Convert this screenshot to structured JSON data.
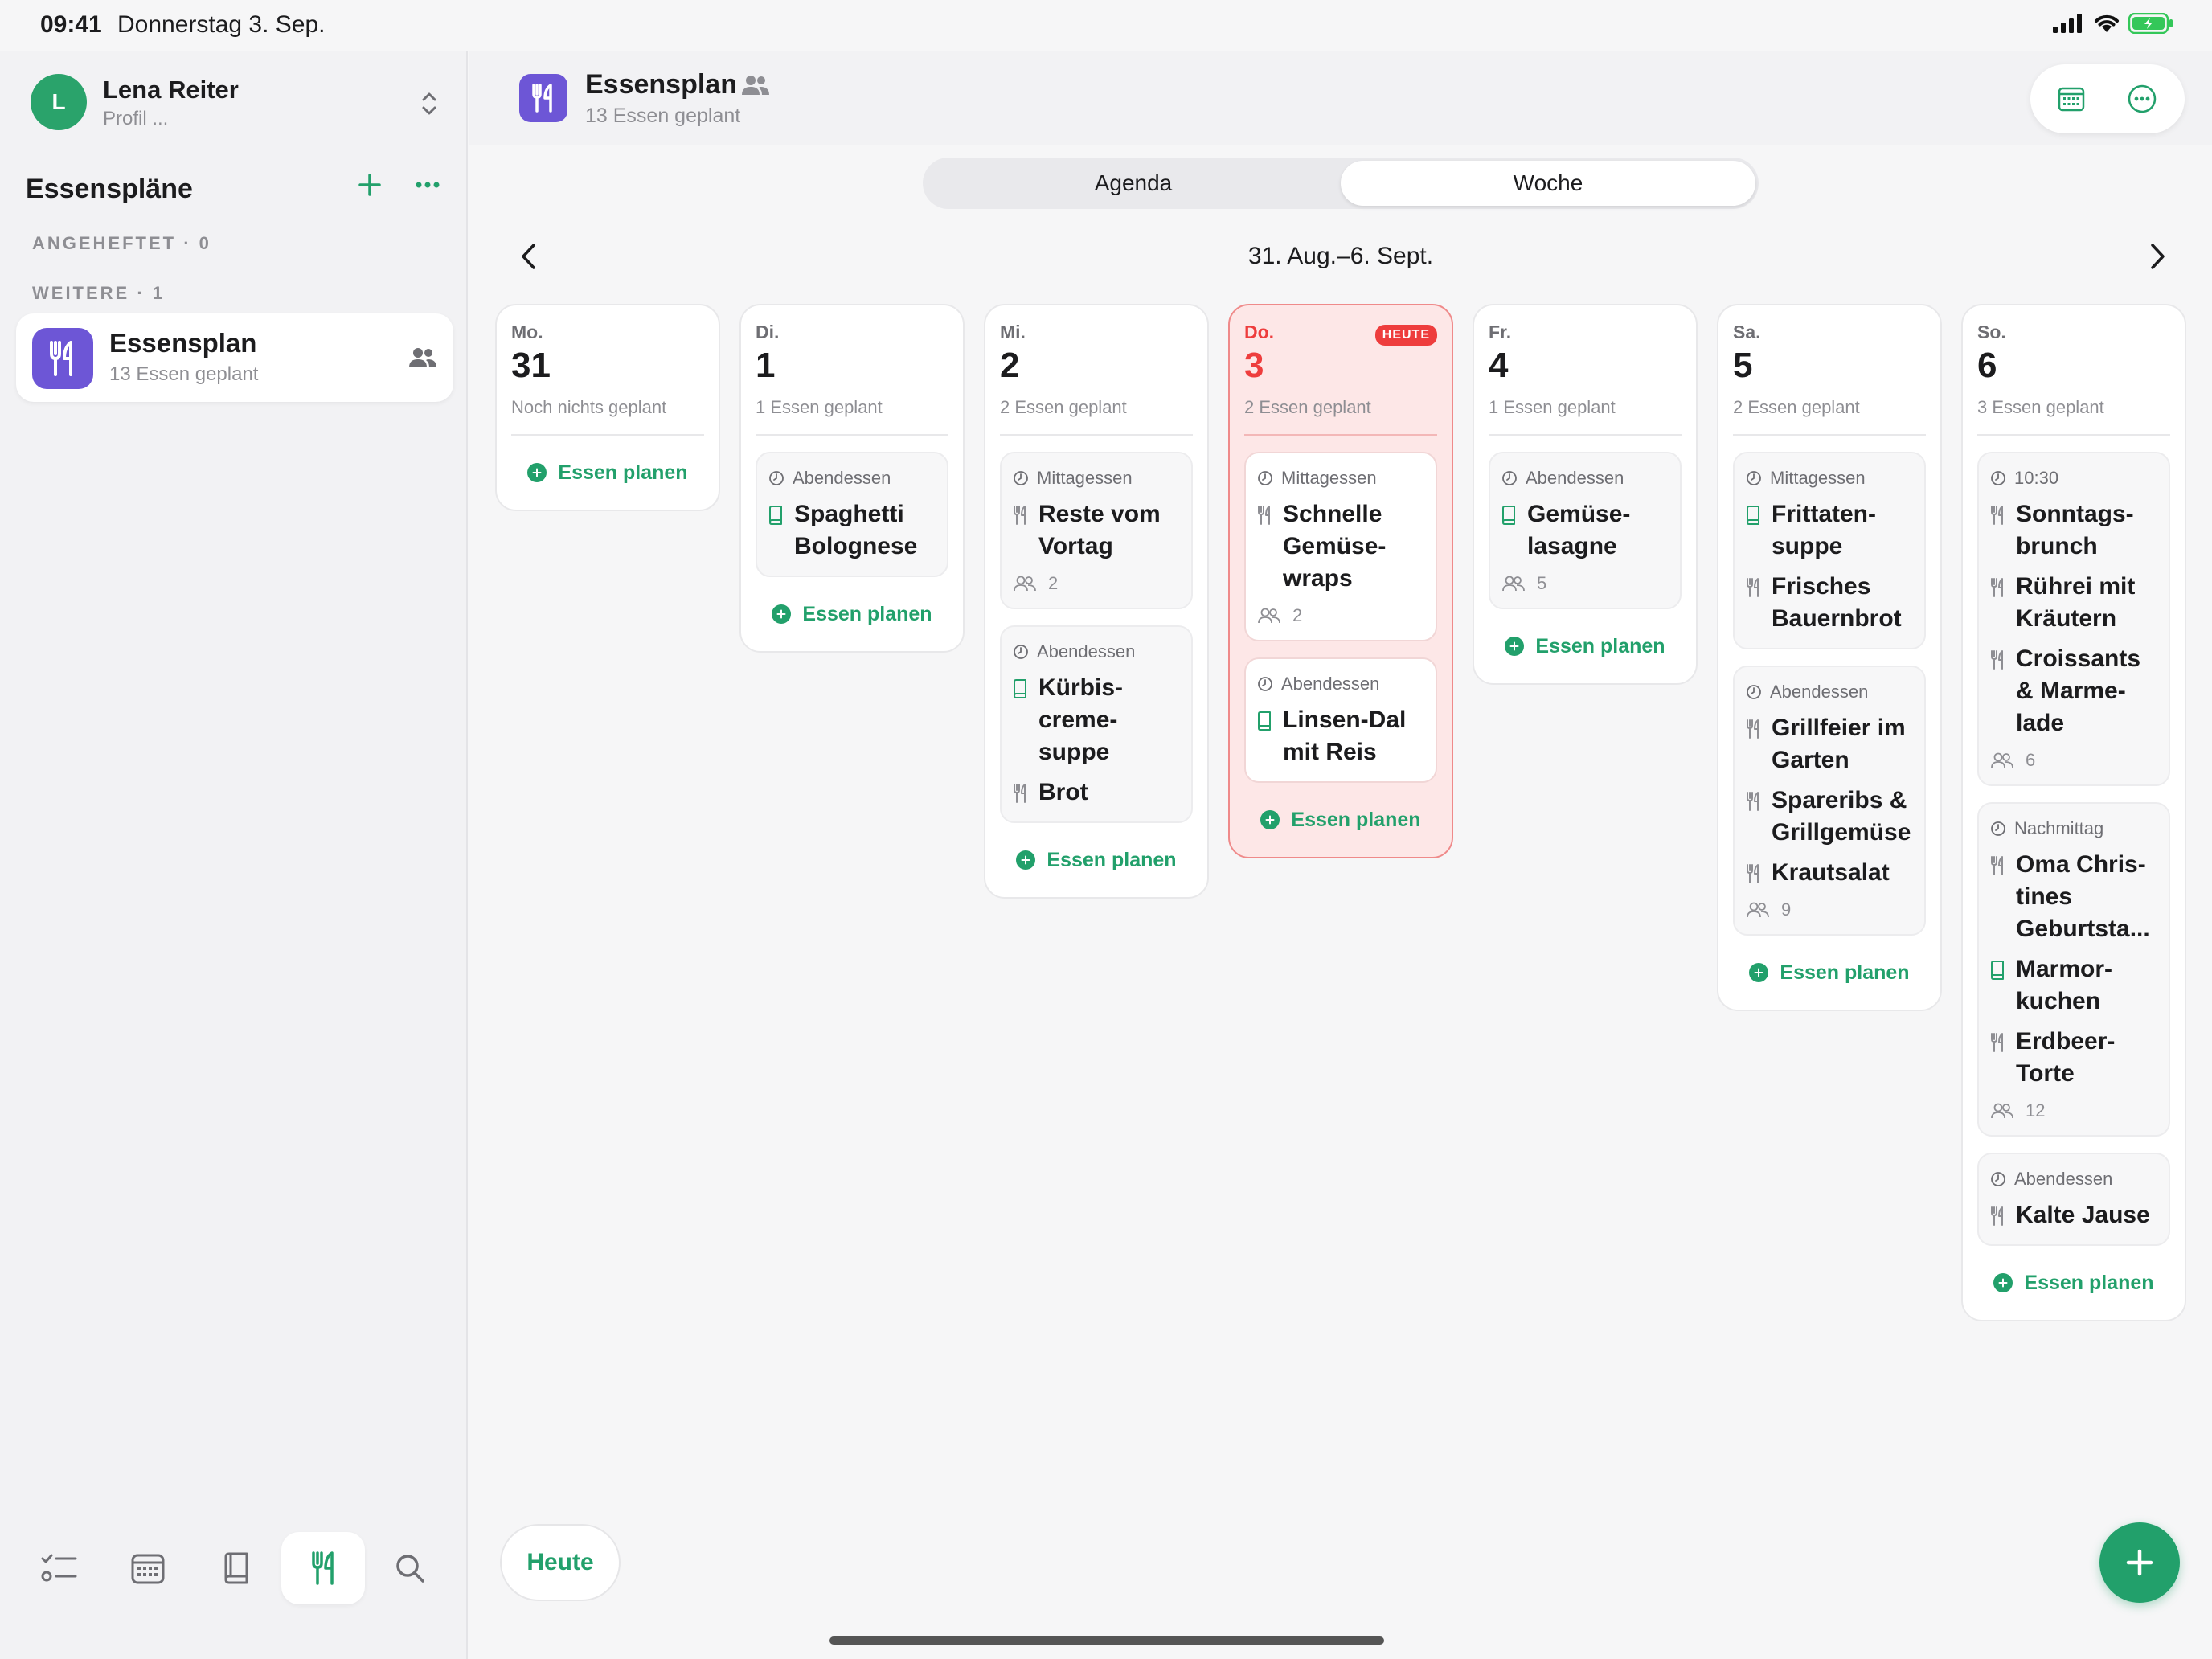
{
  "status": {
    "time": "09:41",
    "date": "Donnerstag 3. Sep."
  },
  "profile": {
    "initial": "L",
    "name": "Lena Reiter",
    "sub": "Profil ..."
  },
  "sidebar": {
    "title": "Essenspläne",
    "pinned_label": "ANGEHEFTET · 0",
    "others_label": "WEITERE · 1",
    "plan": {
      "title": "Essensplan",
      "sub": "13 Essen geplant"
    }
  },
  "header": {
    "title": "Essensplan",
    "sub": "13 Essen geplant"
  },
  "segment": {
    "agenda": "Agenda",
    "week": "Woche",
    "selected": "Woche"
  },
  "week_label": "31. Aug.–6. Sept.",
  "plan_label": "Essen planen",
  "heute_button": "Heute",
  "today_badge": "HEUTE",
  "colors": {
    "accent": "#22a06b",
    "today": "#ee3d3d",
    "plan_icon": "#6d56d6"
  },
  "days": [
    {
      "dow": "Mo.",
      "num": "31",
      "count": "Noch nichts geplant",
      "today": false,
      "meals": []
    },
    {
      "dow": "Di.",
      "num": "1",
      "count": "1 Essen geplant",
      "today": false,
      "meals": [
        {
          "time": "Abendessen",
          "items": [
            {
              "icon": "book",
              "text": "Spaghetti Bolognese"
            }
          ]
        }
      ]
    },
    {
      "dow": "Mi.",
      "num": "2",
      "count": "2 Essen geplant",
      "today": false,
      "meals": [
        {
          "time": "Mittagessen",
          "items": [
            {
              "icon": "fork",
              "text": "Reste vom Vortag"
            }
          ],
          "people": "2"
        },
        {
          "time": "Abendessen",
          "items": [
            {
              "icon": "book",
              "text": "Kürbis-creme-suppe"
            },
            {
              "icon": "fork",
              "text": "Brot"
            }
          ]
        }
      ]
    },
    {
      "dow": "Do.",
      "num": "3",
      "count": "2 Essen geplant",
      "today": true,
      "meals": [
        {
          "time": "Mittagessen",
          "items": [
            {
              "icon": "fork",
              "text": "Schnelle Gemüse-wraps"
            }
          ],
          "people": "2"
        },
        {
          "time": "Abendessen",
          "items": [
            {
              "icon": "book",
              "text": "Linsen-Dal mit Reis"
            }
          ]
        }
      ]
    },
    {
      "dow": "Fr.",
      "num": "4",
      "count": "1 Essen geplant",
      "today": false,
      "meals": [
        {
          "time": "Abendessen",
          "items": [
            {
              "icon": "book",
              "text": "Gemüse-lasagne"
            }
          ],
          "people": "5"
        }
      ]
    },
    {
      "dow": "Sa.",
      "num": "5",
      "count": "2 Essen geplant",
      "today": false,
      "meals": [
        {
          "time": "Mittagessen",
          "items": [
            {
              "icon": "book",
              "text": "Frittaten-suppe"
            },
            {
              "icon": "fork",
              "text": "Frisches Bauernbrot"
            }
          ]
        },
        {
          "time": "Abendessen",
          "items": [
            {
              "icon": "fork",
              "text": "Grillfeier im Garten"
            },
            {
              "icon": "fork",
              "text": "Spareribs & Grillgemüse"
            },
            {
              "icon": "fork",
              "text": "Krautsalat"
            }
          ],
          "people": "9"
        }
      ]
    },
    {
      "dow": "So.",
      "num": "6",
      "count": "3 Essen geplant",
      "today": false,
      "meals": [
        {
          "time": "10:30",
          "items": [
            {
              "icon": "fork",
              "text": "Sonntags-brunch"
            },
            {
              "icon": "fork",
              "text": "Rührei mit Kräutern"
            },
            {
              "icon": "fork",
              "text": "Croissants & Marme-lade"
            }
          ],
          "people": "6"
        },
        {
          "time": "Nachmittag",
          "items": [
            {
              "icon": "fork",
              "text": "Oma Chris-tines Geburtsta..."
            },
            {
              "icon": "book",
              "text": "Marmor-kuchen"
            },
            {
              "icon": "fork",
              "text": "Erdbeer-Torte"
            }
          ],
          "people": "12"
        },
        {
          "time": "Abendessen",
          "items": [
            {
              "icon": "fork",
              "text": "Kalte Jause"
            }
          ]
        }
      ]
    }
  ]
}
